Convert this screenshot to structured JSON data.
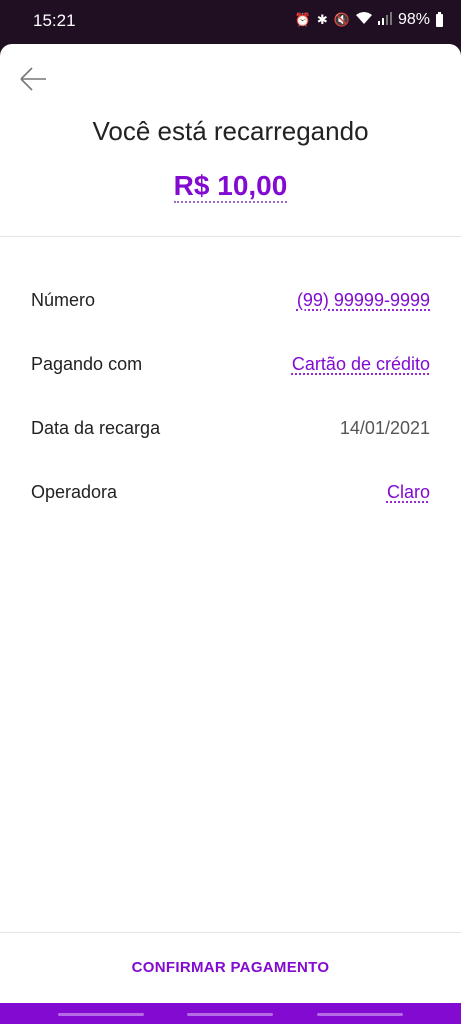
{
  "status_bar": {
    "time": "15:21",
    "battery": "98%",
    "icons": [
      "alarm-icon",
      "bluetooth-icon",
      "mute-icon",
      "wifi-icon",
      "signal-icon",
      "battery-icon"
    ]
  },
  "header": {
    "title": "Você está recarregando",
    "amount": "R$ 10,00"
  },
  "details": [
    {
      "label": "Número",
      "value": "(99) 99999-9999"
    },
    {
      "label": "Pagando com",
      "value": "Cartão de crédito"
    },
    {
      "label": "Data da recarga",
      "value": "14/01/2021"
    },
    {
      "label": "Operadora",
      "value": "Claro"
    }
  ],
  "footer": {
    "confirm_label": "CONFIRMAR PAGAMENTO"
  },
  "colors": {
    "accent": "#820ad1",
    "status_bg": "#200f22"
  }
}
